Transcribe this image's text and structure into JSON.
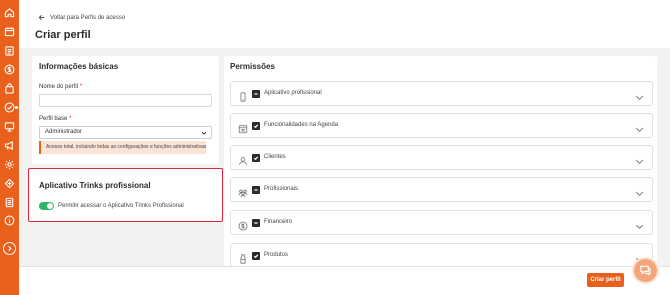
{
  "sidebar": {
    "icons": [
      "home-icon",
      "calendar-icon",
      "clipboard-icon",
      "dollar-icon",
      "bag-icon",
      "megaphone-icon",
      "check-circle-icon",
      "tv-icon",
      "bullhorn-icon",
      "gear-icon",
      "puzzle-icon",
      "document-icon",
      "info-icon"
    ],
    "expand_icon": "chevron-right-icon"
  },
  "header": {
    "back_label": "Voltar para Perfis de acesso",
    "title": "Criar perfil"
  },
  "basic_info": {
    "title": "Informações básicas",
    "name_label": "Nome do perfil",
    "name_value": "",
    "base_label": "Perfil base",
    "base_value": "Administrador",
    "warning": "Acesso total, incluindo todas as configurações e funções administrativas."
  },
  "app_section": {
    "title": "Aplicativo Trinks profissional",
    "toggle_label": "Permitir acessar o Aplicativo Trinks Profissional",
    "toggle_on": true
  },
  "permissions": {
    "title": "Permissões",
    "items": [
      {
        "label": "Aplicativo profissional",
        "icon": "phone-icon",
        "check": "partial"
      },
      {
        "label": "Funcionalidades na Agenda",
        "icon": "calendar-icon",
        "check": "checked"
      },
      {
        "label": "Clientes",
        "icon": "user-icon",
        "check": "checked"
      },
      {
        "label": "Profissionais",
        "icon": "team-icon",
        "check": "partial"
      },
      {
        "label": "Financeiro",
        "icon": "dollar-icon",
        "check": "partial"
      },
      {
        "label": "Produtos",
        "icon": "bottle-icon",
        "check": "checked"
      }
    ]
  },
  "footer": {
    "create_label": "Criar perfil"
  },
  "colors": {
    "brand": "#e8601c",
    "toggle_on": "#2fb56a",
    "highlight_border": "#e0253a"
  }
}
